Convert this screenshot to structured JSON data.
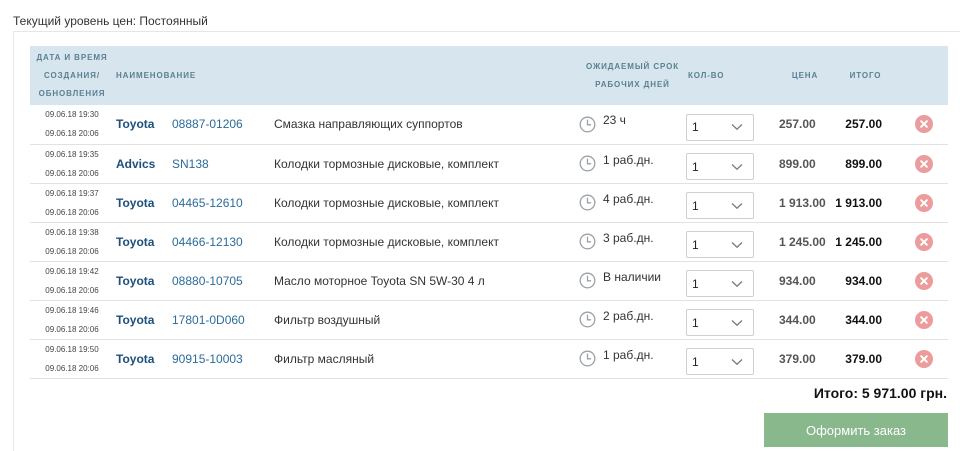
{
  "price_level": "Текущий уровень цен: Постоянный",
  "headers": {
    "datetime_lines": [
      "Дата и время",
      "создания/",
      "обновления"
    ],
    "name": "Наименование",
    "term_lines": [
      "Ожидаемый срок",
      "рабочих дней"
    ],
    "qty": "Кол-во",
    "price": "Цена",
    "total": "Итого"
  },
  "icons": {
    "term": "clock-icon",
    "qty": "chevron-down-icon",
    "remove": "remove-icon"
  },
  "colors": {
    "header_bg": "#d7e6ee",
    "brand": "#1c4f7a",
    "article_link": "#2b6c99",
    "remove": "#ec9c9c",
    "order_button": "#88b88c"
  },
  "rows": [
    {
      "created": "09.06.18 19:30",
      "updated": "09.06.18 20:06",
      "brand": "Toyota",
      "article": "08887-01206",
      "description": "Смазка направляющих суппортов",
      "term": "23 ч",
      "qty": "1",
      "price": "257.00",
      "total": "257.00"
    },
    {
      "created": "09.06.18 19:35",
      "updated": "09.06.18 20:06",
      "brand": "Advics",
      "article": "SN138",
      "description": "Колодки тормозные дисковые, комплект",
      "term": "1 раб.дн.",
      "qty": "1",
      "price": "899.00",
      "total": "899.00"
    },
    {
      "created": "09.06.18 19:37",
      "updated": "09.06.18 20:06",
      "brand": "Toyota",
      "article": "04465-12610",
      "description": "Колодки тормозные дисковые, комплект",
      "term": "4 раб.дн.",
      "qty": "1",
      "price": "1 913.00",
      "total": "1 913.00"
    },
    {
      "created": "09.06.18 19:38",
      "updated": "09.06.18 20:06",
      "brand": "Toyota",
      "article": "04466-12130",
      "description": "Колодки тормозные дисковые, комплект",
      "term": "3 раб.дн.",
      "qty": "1",
      "price": "1 245.00",
      "total": "1 245.00"
    },
    {
      "created": "09.06.18 19:42",
      "updated": "09.06.18 20:06",
      "brand": "Toyota",
      "article": "08880-10705",
      "description": "Масло моторное Toyota SN 5W-30 4 л",
      "term": "В наличии",
      "qty": "1",
      "price": "934.00",
      "total": "934.00"
    },
    {
      "created": "09.06.18 19:46",
      "updated": "09.06.18 20:06",
      "brand": "Toyota",
      "article": "17801-0D060",
      "description": "Фильтр воздушный",
      "term": "2 раб.дн.",
      "qty": "1",
      "price": "344.00",
      "total": "344.00"
    },
    {
      "created": "09.06.18 19:50",
      "updated": "09.06.18 20:06",
      "brand": "Toyota",
      "article": "90915-10003",
      "description": "Фильтр масляный",
      "term": "1 раб.дн.",
      "qty": "1",
      "price": "379.00",
      "total": "379.00"
    }
  ],
  "grand_total": "Итого: 5 971.00 грн.",
  "order_button": "Оформить заказ"
}
